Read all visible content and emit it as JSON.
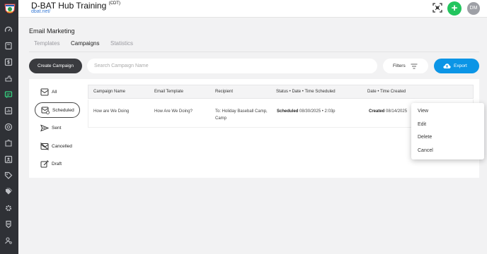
{
  "header": {
    "title": "D-BAT Hub Training",
    "timezone": "(CDT)",
    "url": "dbat.net/",
    "user_initials": "DM",
    "add_label": "+",
    "accent_color": "#22c55e"
  },
  "sidebar": {
    "logo": "dbat-logo",
    "items": [
      {
        "icon": "gauge-icon",
        "active": false
      },
      {
        "icon": "book-icon",
        "active": false
      },
      {
        "icon": "dollar-icon",
        "active": false
      },
      {
        "icon": "hand-icon",
        "active": false
      },
      {
        "icon": "message-icon",
        "active": true
      },
      {
        "icon": "chart-icon",
        "active": false
      },
      {
        "icon": "target-icon",
        "active": false
      },
      {
        "icon": "puzzle-icon",
        "active": false
      },
      {
        "icon": "person-card-icon",
        "active": false
      },
      {
        "icon": "tag-icon",
        "active": false
      },
      {
        "icon": "tags-icon",
        "active": false
      },
      {
        "icon": "gear-icon",
        "active": false
      },
      {
        "icon": "badge-icon",
        "active": false
      },
      {
        "icon": "user-gear-icon",
        "active": false
      }
    ]
  },
  "page": {
    "title": "Email Marketing",
    "tabs": [
      {
        "label": "Templates",
        "active": false
      },
      {
        "label": "Campaigns",
        "active": true
      },
      {
        "label": "Statistics",
        "active": false
      }
    ]
  },
  "toolbar": {
    "create_label": "Create Campaign",
    "search_placeholder": "Search Campaign Name",
    "filters_label": "Filters",
    "export_label": "Export"
  },
  "folders": [
    {
      "label": "All",
      "icon": "inbox-icon",
      "active": false
    },
    {
      "label": "Scheduled",
      "icon": "scheduled-mail-icon",
      "active": true
    },
    {
      "label": "Sent",
      "icon": "send-icon",
      "active": false
    },
    {
      "label": "Cancelled",
      "icon": "cancelled-mail-icon",
      "active": false
    },
    {
      "label": "Draft",
      "icon": "draft-icon",
      "active": false
    }
  ],
  "table": {
    "columns": [
      "Campaign Name",
      "Email Template",
      "Recipient",
      "Status • Date • Time Scheduled",
      "Date • Time Created"
    ],
    "rows": [
      {
        "campaign_name": "How are We Doing",
        "email_template": "How Are We Doing?",
        "recipient_line1": "To: Holiday Baseball Camp,",
        "recipient_line2": "Camp",
        "status": "Scheduled",
        "scheduled": "08/30/2025 • 2:03p",
        "created_status": "Created",
        "created": "08/14/2025"
      }
    ]
  },
  "context_menu": {
    "items": [
      "View",
      "Edit",
      "Delete",
      "Cancel"
    ]
  },
  "colors": {
    "sidebar_bg": "#2f3136",
    "export_bg": "#0b95e6",
    "create_bg": "#3a3b3f"
  }
}
